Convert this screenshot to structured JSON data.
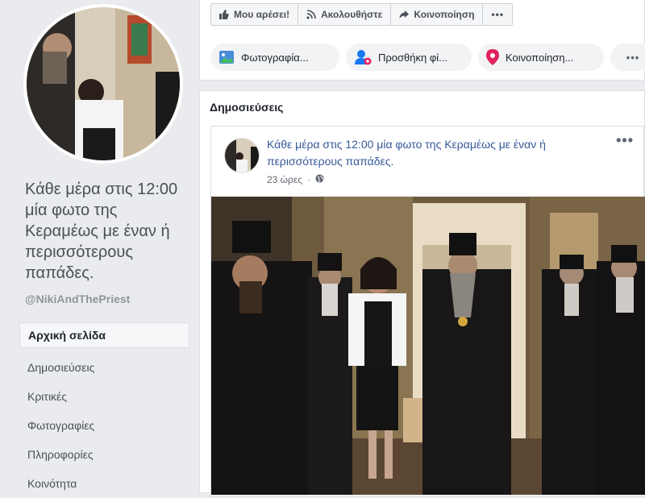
{
  "page": {
    "name": "Κάθε μέρα στις 12:00 μία φωτο της Κεραμέως με έναν ή περισσότερους παπάδες.",
    "handle": "@NikiAndThePriest"
  },
  "nav": {
    "items": [
      {
        "label": "Αρχική σελίδα",
        "active": true
      },
      {
        "label": "Δημοσιεύσεις"
      },
      {
        "label": "Κριτικές"
      },
      {
        "label": "Φωτογραφίες"
      },
      {
        "label": "Πληροφορίες"
      },
      {
        "label": "Κοινότητα"
      }
    ]
  },
  "actions": {
    "like": "Μου αρέσει!",
    "follow": "Ακολουθήστε",
    "share": "Κοινοποίηση"
  },
  "composer": {
    "photo": "Φωτογραφία...",
    "tag": "Προσθήκη φί...",
    "checkin": "Κοινοποίηση..."
  },
  "posts": {
    "heading": "Δημοσιεύσεις",
    "items": [
      {
        "title": "Κάθε μέρα στις 12:00 μία φωτο της Κεραμέως με έναν ή περισσότερους παπάδες.",
        "time": "23 ώρες",
        "privacy_icon": "globe-icon"
      }
    ]
  },
  "colors": {
    "link": "#365899",
    "bg": "#e9ebee",
    "checkin_red": "#e0245e",
    "photo_green": "#45bd62",
    "tag_blue": "#1877f2"
  }
}
